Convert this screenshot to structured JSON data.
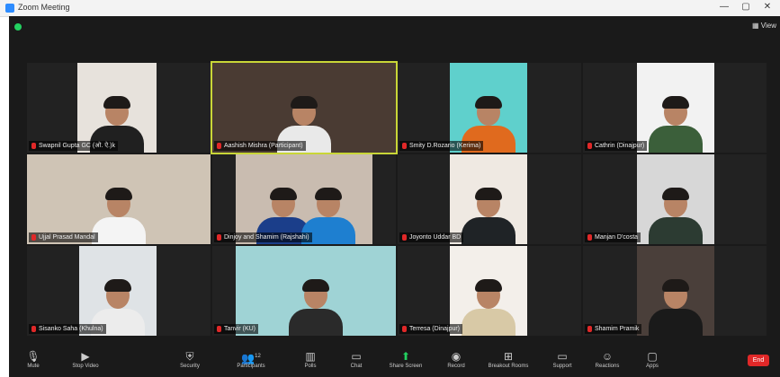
{
  "window": {
    "title": "Zoom Meeting",
    "minimize": "—",
    "maximize": "▢",
    "close": "✕"
  },
  "header": {
    "view_label": "View"
  },
  "participants": [
    {
      "name": "Swapnil Gupta GC (ओ. ऐ.)k"
    },
    {
      "name": "Aashish Mishra (Participant)"
    },
    {
      "name": "Smity D.Rozario (Kerima)"
    },
    {
      "name": "Cathrin (Dinajpur)"
    },
    {
      "name": "Ujjal Prasad Mandal"
    },
    {
      "name": "Dinjoy and Shamim (Rajshahi)"
    },
    {
      "name": "Joyonto Uddar BD"
    },
    {
      "name": "Manjan D'costa"
    },
    {
      "name": "Sisanko Saha (Khulna)"
    },
    {
      "name": "Tanvir (KU)"
    },
    {
      "name": "Terresa (Dinajpur)"
    },
    {
      "name": "Shamim Pramik"
    }
  ],
  "toolbar": {
    "mute": "Mute",
    "stop_video": "Stop Video",
    "security": "Security",
    "participants": "Participants",
    "participants_count": "12",
    "polls": "Polls",
    "chat": "Chat",
    "share_screen": "Share Screen",
    "record": "Record",
    "breakout_rooms": "Breakout Rooms",
    "support": "Support",
    "reactions": "Reactions",
    "apps": "Apps",
    "end": "End"
  },
  "colors": {
    "active_speaker_border": "#c9d637",
    "share_green": "#23d160",
    "end_red": "#e02828"
  }
}
